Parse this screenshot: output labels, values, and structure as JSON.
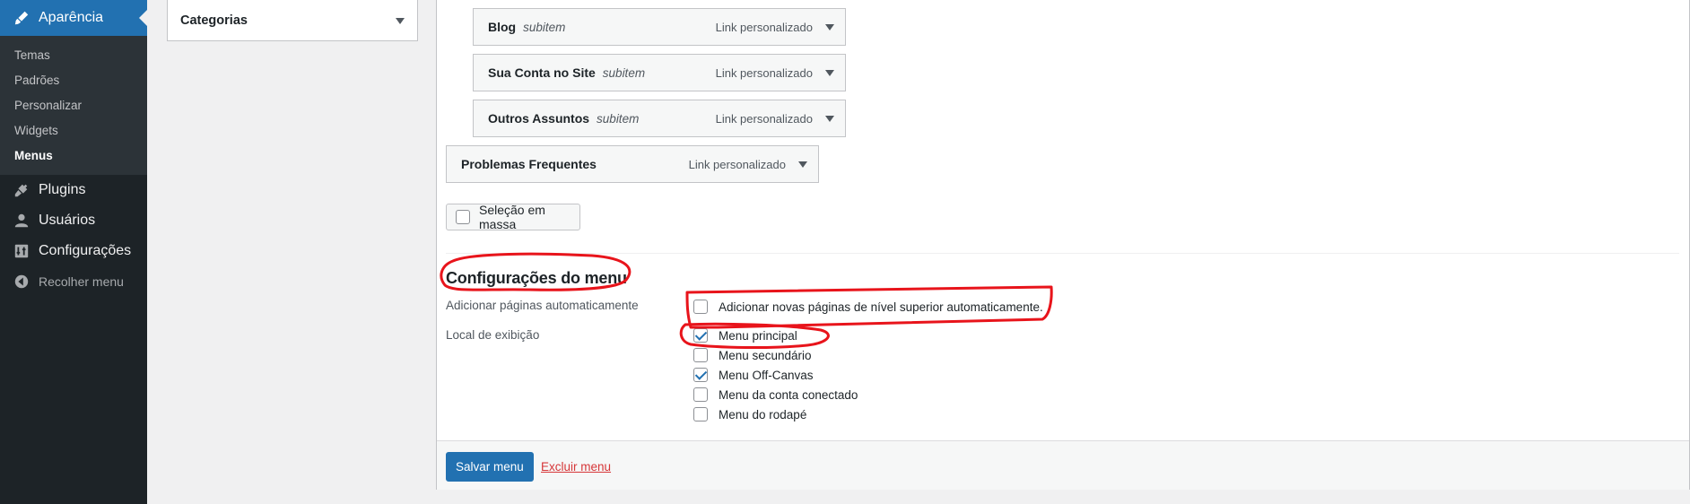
{
  "sidebar": {
    "active": {
      "label": "Aparência",
      "icon": "paintbrush-icon"
    },
    "submenu": [
      "Temas",
      "Padrões",
      "Personalizar",
      "Widgets",
      "Menus"
    ],
    "current_submenu": "Menus",
    "items": [
      {
        "label": "Plugins",
        "icon": "plugin-icon"
      },
      {
        "label": "Usuários",
        "icon": "user-icon"
      },
      {
        "label": "Configurações",
        "icon": "settings-icon"
      },
      {
        "label": "Recolher menu",
        "icon": "collapse-icon"
      }
    ]
  },
  "categories_box": {
    "title": "Categorias"
  },
  "menu_items": [
    {
      "title": "Blog",
      "sub": "subitem",
      "type": "Link personalizado"
    },
    {
      "title": "Sua Conta no Site",
      "sub": "subitem",
      "type": "Link personalizado"
    },
    {
      "title": "Outros Assuntos",
      "sub": "subitem",
      "type": "Link personalizado"
    },
    {
      "title": "Problemas Frequentes",
      "sub": "",
      "type": "Link personalizado"
    }
  ],
  "bulk_select": {
    "label": "Seleção em massa",
    "checked": false
  },
  "menu_settings": {
    "title": "Configurações do menu",
    "auto_add_label": "Adicionar páginas automaticamente",
    "auto_add_option": {
      "label": "Adicionar novas páginas de nível superior automaticamente.",
      "checked": false
    },
    "locations_label": "Local de exibição",
    "locations": [
      {
        "label": "Menu principal",
        "checked": true
      },
      {
        "label": "Menu secundário",
        "checked": false
      },
      {
        "label": "Menu Off-Canvas",
        "checked": true
      },
      {
        "label": "Menu da conta conectado",
        "checked": false
      },
      {
        "label": "Menu do rodapé",
        "checked": false
      }
    ]
  },
  "footer": {
    "save_label": "Salvar menu",
    "delete_label": "Excluir menu"
  },
  "colors": {
    "accent": "#2271b1",
    "sidebar_bg": "#1d2327",
    "danger": "#d63638",
    "annotation": "#e8141b"
  }
}
